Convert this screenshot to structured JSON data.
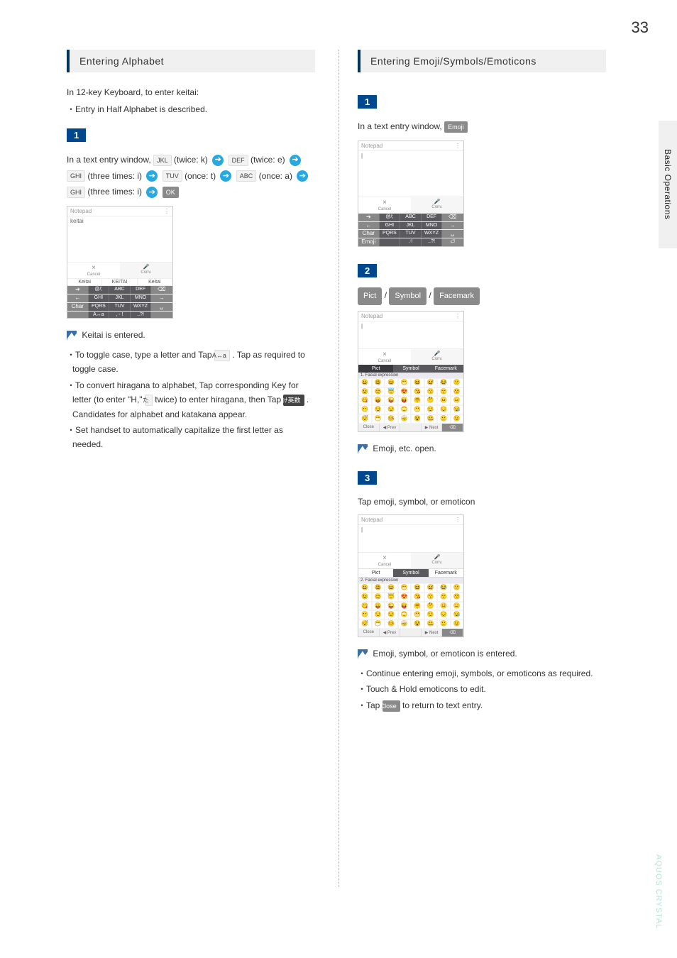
{
  "page_number": "33",
  "side_tab": "Basic Operations",
  "footer": "AQUOS CRYSTAL",
  "left": {
    "header": "Entering Alphabet",
    "intro": "In 12-key Keyboard, to enter keitai:",
    "note": "・Entry in Half Alphabet is described.",
    "step1": {
      "badge": "1",
      "pre": "In a text entry window, ",
      "k_jkl": "JKL",
      "k_jkl_times": " (twice: k) ",
      "k_def": "DEF",
      "k_def_times": " (twice: e) ",
      "k_ghi1": "GHI",
      "k_ghi1_times": " (three times: i) ",
      "k_tuv": "TUV",
      "k_tuv_times": " (once: t) ",
      "k_abc": "ABC",
      "k_abc_times": " (once: a) ",
      "k_ghi2": "GHI",
      "k_ghi2_times": " (three times: i) ",
      "k_ok": "OK"
    },
    "result": "Keitai is entered.",
    "tips": [
      "・To toggle case, type a letter and Tap ",
      " . Tap as required to toggle case.",
      "・To convert hiragana to alphabet, Tap corresponding Key for letter (to enter \"H,\" ",
      " twice) to enter hiragana, then Tap ",
      " . Candidates for alphabet and katakana appear.",
      "・Set handset to automatically capitalize the first letter as needed."
    ],
    "key_case": "A↔a",
    "key_ha": "た",
    "key_alpha": "ｶﾅ英数",
    "screenshot": {
      "title": "Notepad",
      "text": "keitai",
      "cancel": "Cancel",
      "conv": "Conv.",
      "x": "×",
      "mic": "🎤",
      "suggest": [
        "Keitai",
        "KEITAI",
        "Keitai"
      ],
      "keys": [
        [
          "➔",
          "@/;",
          "ABC",
          "DEF",
          "⌫"
        ],
        [
          "←",
          "GHI",
          "JKL",
          "MNO",
          "→"
        ],
        [
          "Char",
          "PQRS",
          "TUV",
          "WXYZ",
          "␣"
        ],
        [
          "",
          "A↔a",
          ", - !",
          "..?!",
          ""
        ]
      ]
    }
  },
  "right": {
    "header": "Entering Emoji/Symbols/Emoticons",
    "step1": {
      "badge": "1",
      "text": "In a text entry window, ",
      "btn": "Emoji"
    },
    "step2": {
      "badge": "2",
      "tabs": [
        "Pict",
        "Symbol",
        "Facemark"
      ],
      "sep": " / "
    },
    "result2": "Emoji, etc. open.",
    "step3": {
      "badge": "3",
      "text": "Tap emoji, symbol, or emoticon"
    },
    "result3": "Emoji, symbol, or emoticon is entered.",
    "tips": [
      "・Continue entering emoji, symbols, or emoticons as required.",
      "・Touch & Hold emoticons to edit.",
      "・Tap ",
      " to return to text entry."
    ],
    "close_btn": "Close",
    "screenshot1": {
      "title": "Notepad",
      "cancel": "Cancel",
      "conv": "Conv.",
      "x": "×",
      "mic": "🎤",
      "keys": [
        [
          "➔",
          "@/;",
          "ABC",
          "DEF",
          "⌫"
        ],
        [
          "←",
          "GHI",
          "JKL",
          "MNO",
          "→"
        ],
        [
          "Char",
          "PQRS",
          "TUV",
          "WXYZ",
          "␣"
        ],
        [
          "Emoji",
          "",
          ".-!",
          "..?!",
          "⏎"
        ]
      ]
    },
    "screenshot2": {
      "title": "Notepad",
      "cancel": "Cancel",
      "conv": "Conv.",
      "x": "×",
      "mic": "🎤",
      "tabs": [
        "Pict",
        "Symbol",
        "Facemark"
      ],
      "cat": "1. Facial expression",
      "bottom": [
        "Close",
        "◀ Prev",
        "",
        "▶ Next",
        "⌫"
      ]
    },
    "screenshot3": {
      "title": "Notepad",
      "cancel": "Cancel",
      "conv": "Conv.",
      "x": "×",
      "mic": "🎤",
      "tabs": [
        "Pict",
        "Symbol",
        "Facemark"
      ],
      "cat": "2. Facial expression",
      "bottom": [
        "Close",
        "◀ Prev",
        "",
        "▶ Next",
        "⌫"
      ]
    }
  }
}
